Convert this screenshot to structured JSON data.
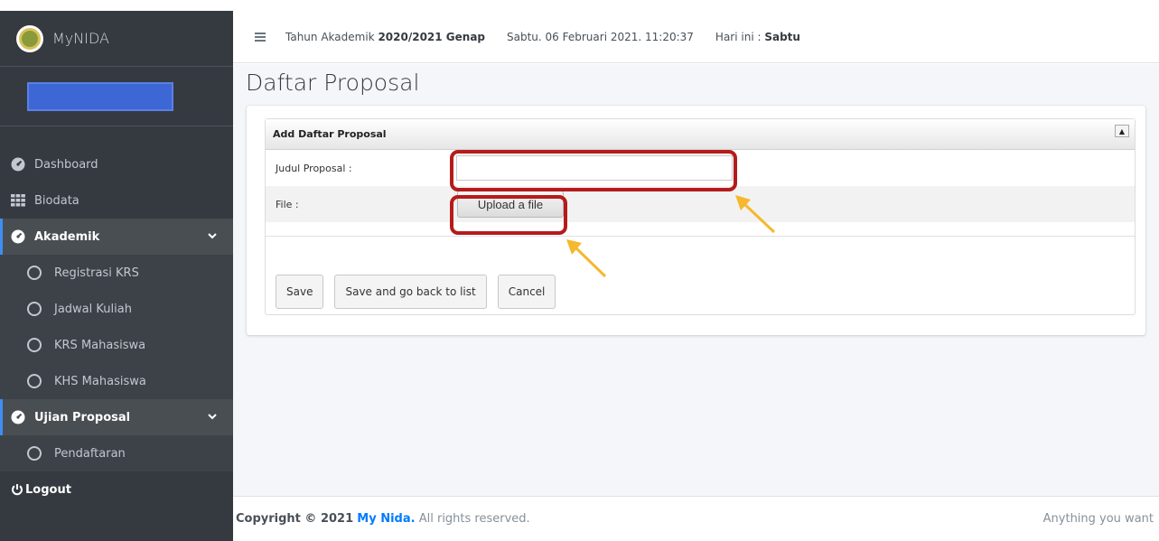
{
  "app": {
    "brand": "MyNIDA"
  },
  "sidebar": {
    "items": [
      {
        "label": "Dashboard",
        "icon": "tachometer-icon"
      },
      {
        "label": "Biodata",
        "icon": "grid-icon"
      },
      {
        "label": "Akademik",
        "icon": "tachometer-icon",
        "active": true,
        "expanded": true
      },
      {
        "label": "Registrasi KRS",
        "icon": "circle-icon"
      },
      {
        "label": "Jadwal Kuliah",
        "icon": "circle-icon"
      },
      {
        "label": "KRS Mahasiswa",
        "icon": "circle-icon"
      },
      {
        "label": "KHS Mahasiswa",
        "icon": "circle-icon"
      },
      {
        "label": "Ujian Proposal",
        "icon": "tachometer-icon",
        "active": true,
        "expanded": true
      },
      {
        "label": "Pendaftaran",
        "icon": "circle-icon"
      }
    ],
    "logout": "Logout"
  },
  "header": {
    "academic_prefix": "Tahun Akademik",
    "academic_year": "2020/2021 Genap",
    "datetime": "Sabtu. 06 Februari 2021. 11:20:37",
    "today_prefix": "Hari ini :",
    "today": "Sabtu"
  },
  "page": {
    "title": "Daftar Proposal"
  },
  "form": {
    "heading": "Add Daftar Proposal",
    "fields": [
      {
        "label": "Judul Proposal :",
        "value": "",
        "placeholder": ""
      },
      {
        "label": "File :",
        "button": "Upload a file"
      }
    ],
    "buttons": {
      "save": "Save",
      "save_back": "Save and go back to list",
      "cancel": "Cancel"
    }
  },
  "footer": {
    "prefix": "Copyright © 2021",
    "link": "My Nida.",
    "suffix": "All rights reserved.",
    "right": "Anything you want"
  },
  "colors": {
    "sidebar_bg": "#343a40",
    "active_accent": "#3f8ef5",
    "highlight_border": "#b51b1b",
    "arrow": "#f5b82e",
    "link": "#007bff"
  }
}
